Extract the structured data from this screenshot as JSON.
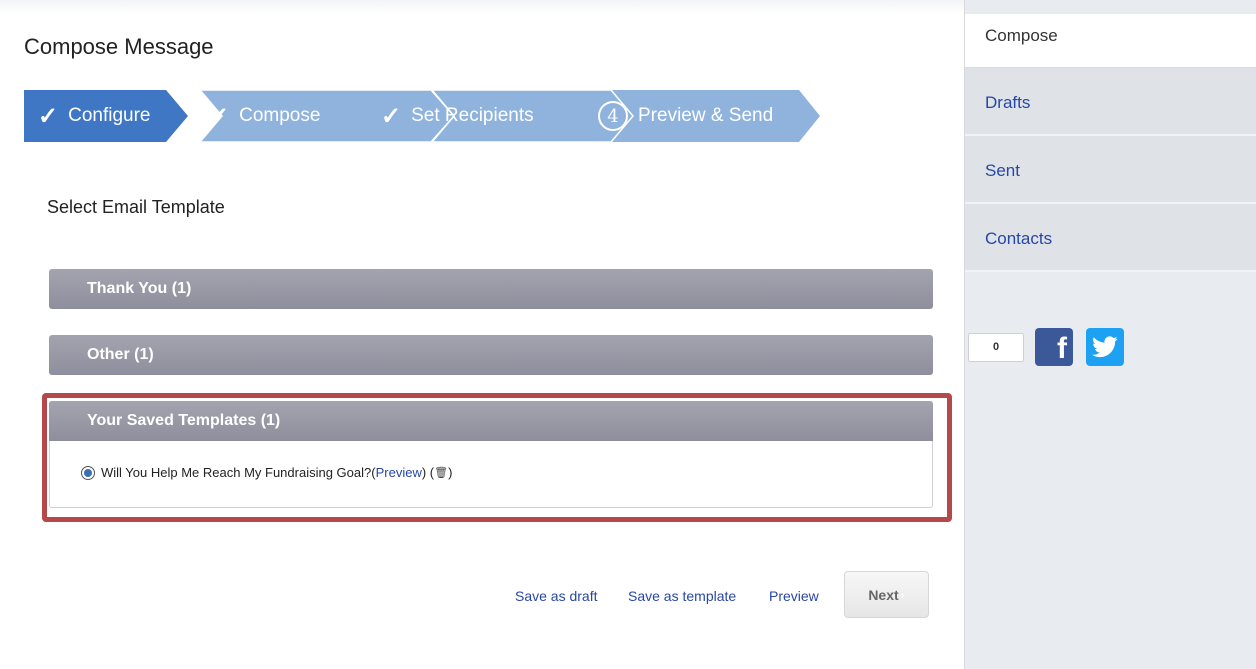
{
  "header": {
    "title": "Compose Message"
  },
  "wizard": {
    "steps": [
      {
        "label": "Configure",
        "marker": "✓"
      },
      {
        "label": "Compose",
        "marker": "✓"
      },
      {
        "label": "Set Recipients",
        "marker": "✓"
      },
      {
        "label": "Preview & Send",
        "marker": "4"
      }
    ]
  },
  "templates": {
    "section_label": "Select Email Template",
    "groups": [
      {
        "label": "Thank You (1)"
      },
      {
        "label": "Other (1)"
      },
      {
        "label": "Your Saved Templates (1)"
      }
    ],
    "saved_item": {
      "title": "Will You Help Me Reach My Fundraising Goal?",
      "open_paren": " (",
      "preview_link": "Preview",
      "close_paren": ") (",
      "trash_glyph": "🗑",
      "end_paren": ")",
      "selected": true
    }
  },
  "footer": {
    "save_draft": "Save as draft",
    "save_template": "Save as template",
    "preview": "Preview",
    "next": "Next"
  },
  "sidebar": {
    "compose": "Compose",
    "items": [
      {
        "label": "Drafts"
      },
      {
        "label": "Sent"
      },
      {
        "label": "Contacts"
      }
    ],
    "share_count": "0"
  },
  "colors": {
    "wizard_active": "#3f77c4",
    "wizard_inactive": "#8fb3dc",
    "accordion": "#9796a4",
    "highlight_border": "#b5484a",
    "link": "#2747a6"
  }
}
